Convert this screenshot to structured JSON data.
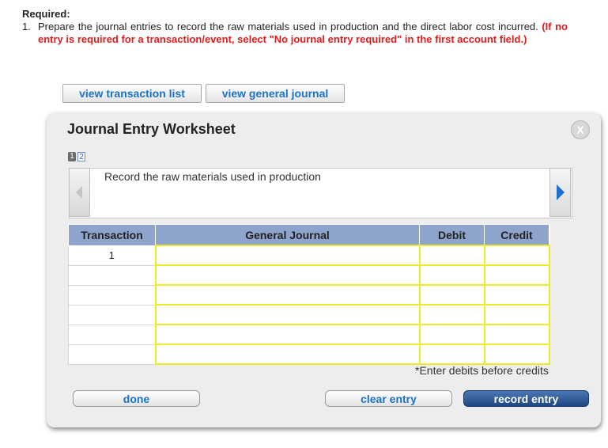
{
  "required": {
    "title": "Required:",
    "number": "1.",
    "text": "Prepare the journal entries to record the raw materials used in production and the direct labor cost incurred.",
    "note": "(If no entry is required for a transaction/event, select \"No journal entry required\" in the first account field.)"
  },
  "top_buttons": {
    "transaction_list": "view transaction list",
    "general_journal": "view general journal"
  },
  "worksheet": {
    "title": "Journal Entry Worksheet",
    "close_label": "X",
    "pages": [
      "1",
      "2"
    ],
    "instruction": "Record the raw materials used in production",
    "columns": [
      "Transaction",
      "General Journal",
      "Debit",
      "Credit"
    ],
    "rows": [
      {
        "transaction": "1",
        "account": "",
        "debit": "",
        "credit": ""
      },
      {
        "transaction": "",
        "account": "",
        "debit": "",
        "credit": ""
      },
      {
        "transaction": "",
        "account": "",
        "debit": "",
        "credit": ""
      },
      {
        "transaction": "",
        "account": "",
        "debit": "",
        "credit": ""
      },
      {
        "transaction": "",
        "account": "",
        "debit": "",
        "credit": ""
      },
      {
        "transaction": "",
        "account": "",
        "debit": "",
        "credit": ""
      }
    ],
    "footnote": "*Enter debits before credits",
    "buttons": {
      "done": "done",
      "clear": "clear entry",
      "record": "record entry"
    }
  }
}
